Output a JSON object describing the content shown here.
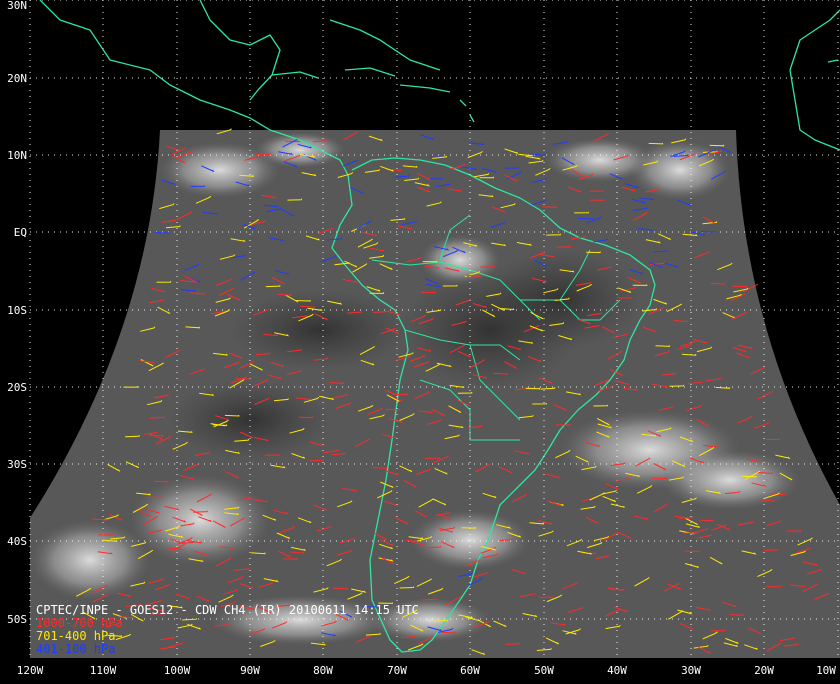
{
  "title": "CPTEC/INPE - GOES12 - CDW CH4 (IR) 20100611 14:15 UTC",
  "legend": [
    {
      "label": "1000-700 hPa",
      "color": "#ff2a2a"
    },
    {
      "label": "701-400 hPa",
      "color": "#ffea00"
    },
    {
      "label": "401-100 hPa",
      "color": "#1e3cff"
    }
  ],
  "lat_labels": [
    "30N",
    "20N",
    "10N",
    "EQ",
    "10S",
    "20S",
    "30S",
    "40S",
    "50S"
  ],
  "lon_labels": [
    "120W",
    "110W",
    "100W",
    "90W",
    "80W",
    "70W",
    "60W",
    "50W",
    "40W",
    "30W",
    "20W",
    "10W"
  ],
  "colors": {
    "background": "#000000",
    "coastline": "#2ee6a0",
    "grid": "#ffffff",
    "satellite_tone": "#5a5a5a"
  }
}
